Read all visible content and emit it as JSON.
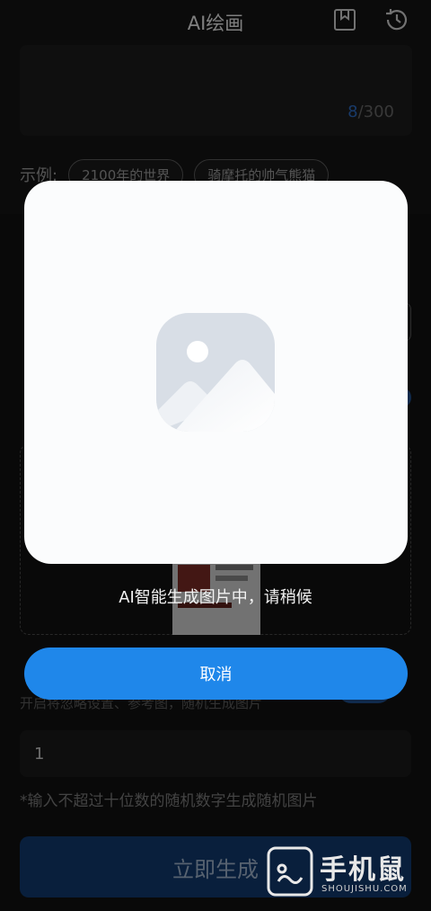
{
  "header": {
    "title": "AI绘画"
  },
  "prompt": {
    "count_current": "8",
    "count_max": "/300"
  },
  "examples": {
    "label": "示例:",
    "chips": [
      "2100年的世界",
      "骑摩托的帅气熊猫"
    ]
  },
  "random": {
    "hint": "开启将忽略设置、参考图，随机生成图片"
  },
  "seed": {
    "value": "1",
    "note": "*输入不超过十位数的随机数字生成随机图片"
  },
  "generate": {
    "label": "立即生成"
  },
  "modal": {
    "status": "AI智能生成图片中，请稍候",
    "cancel_label": "取消"
  },
  "watermark": {
    "brand_cn": "手机鼠",
    "brand_en": "SHOUJISHU.COM"
  },
  "colors": {
    "accent": "#1f87ea",
    "modal_bg": "#fbfcfd",
    "icon_bg": "#d8dee6"
  }
}
